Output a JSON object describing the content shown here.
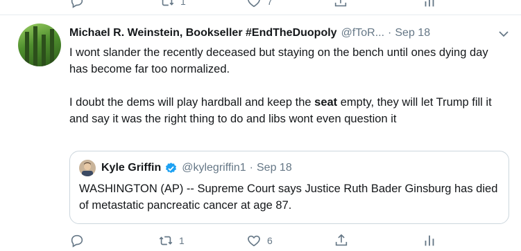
{
  "prev_tweet": {
    "retweet_count": "1",
    "like_count": "7"
  },
  "tweet": {
    "display_name": "Michael R. Weinstein, Bookseller #EndTheDuopoly",
    "handle": "@fToR...",
    "separator": "·",
    "date": "Sep 18",
    "text_line_1": "I wont slander the recently deceased but staying on the bench until ones dying day has become far too normalized.",
    "text_line_2_before": "I doubt the dems will play hardball and keep the ",
    "text_line_2_bold": "seat",
    "text_line_2_after": " empty, they will let Trump fill it and say it was the right thing to do and libs wont even question it",
    "reply_count": "",
    "retweet_count": "1",
    "like_count": "6"
  },
  "quote": {
    "display_name": "Kyle Griffin",
    "handle": "@kylegriffin1",
    "separator": "·",
    "date": "Sep 18",
    "text": "WASHINGTON (AP) -- Supreme Court says Justice Ruth Bader Ginsburg has died of metastatic pancreatic cancer at age 87."
  },
  "colors": {
    "text_primary": "#14171a",
    "text_secondary": "#657786",
    "border": "#ccd6dd",
    "verified_blue": "#1da1f2"
  },
  "icons": {
    "reply": "reply-icon",
    "retweet": "retweet-icon",
    "like": "heart-icon",
    "share": "share-icon",
    "analytics": "analytics-icon",
    "caret": "chevron-down-icon",
    "verified": "verified-badge-icon"
  }
}
